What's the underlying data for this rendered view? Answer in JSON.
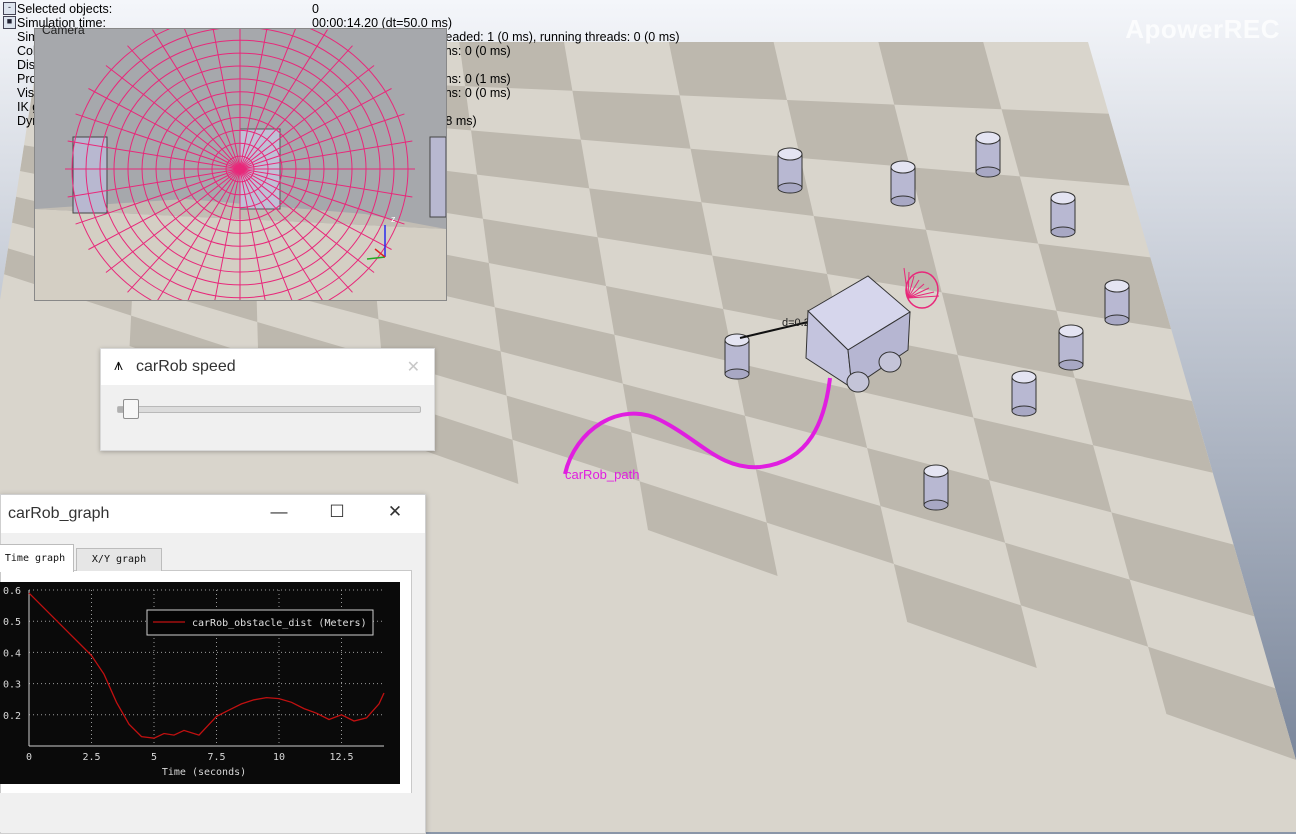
{
  "watermark": "ApowerREC",
  "info_panel": {
    "rows": [
      {
        "label": "Selected objects:",
        "value": "0",
        "button": "-"
      },
      {
        "label": "Simulation time:",
        "value": "00:00:14.20 (dt=50.0 ms)",
        "button": "■"
      },
      {
        "label": "Simulation scripts called/resumed",
        "value": "main: 1 (15 ms), non-threaded: 1 (0 ms), running threads: 0 (0 ms)"
      },
      {
        "label": "Collision handling enabled",
        "value": "Calculations: 0, detections: 0 (0 ms)"
      },
      {
        "label": "Distance handling enabled",
        "value": "Calculations: 1 (2 ms)"
      },
      {
        "label": "Proximity sensor handling enabled",
        "value": "Calculations: 1, detections: 0 (1 ms)"
      },
      {
        "label": "Vision sensor handling enabled (FBO)",
        "value": "Calculations: 0, detections: 0 (0 ms)"
      },
      {
        "label": "IK group handling enabled",
        "value": "Calculations: 0 (0 ms)"
      },
      {
        "label": "Dynamics handling enabled (Bullet 2.78)",
        "value": "Calculation passes: 10 (8 ms)"
      }
    ]
  },
  "camera_view": {
    "title": "Camera",
    "axis_z": "z",
    "axis_y": "y",
    "axis_x": "x"
  },
  "scene": {
    "distance_label": "d=0.27",
    "path_label": "carRob_path",
    "path_color": "#e01ee0",
    "sensor_color": "#e8287a"
  },
  "speed_dialog": {
    "title": "carRob speed",
    "app_icon": "⩚",
    "close_icon": "✕",
    "slider_value": 0.04
  },
  "graph_window": {
    "title": "carRob_graph",
    "minimize_icon": "—",
    "maximize_icon": "☐",
    "close_icon": "✕",
    "tabs": [
      "Time graph",
      "X/Y graph"
    ],
    "active_tab": "Time graph"
  },
  "chart_data": {
    "type": "line",
    "title": "",
    "xlabel": "Time (seconds)",
    "ylabel": "",
    "xlim": [
      0,
      14.2
    ],
    "ylim": [
      0.1,
      0.6
    ],
    "xticks": [
      0,
      2.5,
      5,
      7.5,
      10,
      12.5
    ],
    "xtick_labels": [
      "0",
      "2.5",
      "5",
      "7.5",
      "10",
      "12.5"
    ],
    "yticks": [
      0.2,
      0.3,
      0.4,
      0.5,
      0.6
    ],
    "ytick_labels": [
      "0.2",
      "0.3",
      "0.4",
      "0.5",
      "0.6"
    ],
    "grid": true,
    "background": "#0a0a0a",
    "legend": {
      "placement": "top-right"
    },
    "series": [
      {
        "name": "carRob_obstacle_dist (Meters)",
        "color": "#c01010",
        "x": [
          0,
          0.5,
          1.0,
          1.5,
          2.0,
          2.5,
          3.0,
          3.5,
          4.0,
          4.5,
          5.0,
          5.4,
          5.8,
          6.2,
          6.8,
          7.5,
          8.0,
          8.5,
          9.0,
          9.5,
          10.0,
          10.5,
          11.0,
          11.5,
          12.0,
          12.5,
          13.0,
          13.5,
          14.0,
          14.2
        ],
        "y": [
          0.59,
          0.55,
          0.51,
          0.47,
          0.43,
          0.39,
          0.33,
          0.24,
          0.17,
          0.13,
          0.125,
          0.14,
          0.135,
          0.15,
          0.135,
          0.195,
          0.215,
          0.235,
          0.248,
          0.255,
          0.252,
          0.24,
          0.22,
          0.205,
          0.185,
          0.2,
          0.18,
          0.19,
          0.235,
          0.27
        ]
      }
    ]
  }
}
